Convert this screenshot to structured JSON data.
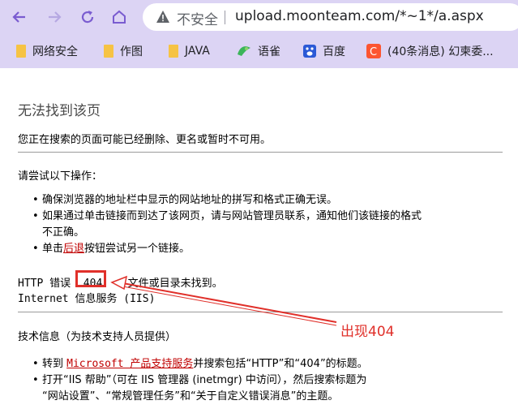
{
  "browser": {
    "insecure_label": "不安全",
    "url": "upload.moonteam.com/*~1*/a.aspx",
    "bookmarks": [
      {
        "label": "网络安全",
        "icon": "folder-icon"
      },
      {
        "label": "作图",
        "icon": "folder-icon"
      },
      {
        "label": "JAVA",
        "icon": "folder-icon"
      },
      {
        "label": "语雀",
        "icon": "yuque-icon"
      },
      {
        "label": "百度",
        "icon": "baidu-icon"
      },
      {
        "label": "(40条消息) 幻柬委...",
        "icon": "csdn-icon"
      }
    ],
    "colors": {
      "chrome": "#dcd4f4",
      "accent": "#7a5cd0"
    }
  },
  "page": {
    "title": "无法找到该页",
    "subtitle": "您正在搜索的页面可能已经删除、更名或暂时不可用。",
    "try_heading": "请尝试以下操作：",
    "try_items": [
      "确保浏览器的地址栏中显示的网站地址的拼写和格式正确无误。",
      "如果通过单击链接而到达了该网页，请与网站管理员联系，通知他们该链接的格式",
      "不正确。"
    ],
    "back_prefix": "单击",
    "back_link": "后退",
    "back_suffix": "按钮尝试另一个链接。",
    "http_error_prefix": "HTTP 错误",
    "error_code": "404",
    "http_error_suffix": "- 文件或目录未找到。",
    "iis_line": "Internet 信息服务 (IIS)",
    "tech_heading": "技术信息（为技术支持人员提供）",
    "tech_item1_prefix": "转到 ",
    "tech_item1_link": "Microsoft 产品支持服务",
    "tech_item1_suffix": "并搜索包括“HTTP”和“404”的标题。",
    "tech_item2_line1": "打开“IIS 帮助”（可在 IIS 管理器 (inetmgr) 中访问），然后搜索标题为",
    "tech_item2_line2": "“网站设置”、“常规管理任务”和“关于自定义错误消息”的主题。"
  },
  "annotation": {
    "text": "出现404",
    "color": "#e0302a"
  }
}
